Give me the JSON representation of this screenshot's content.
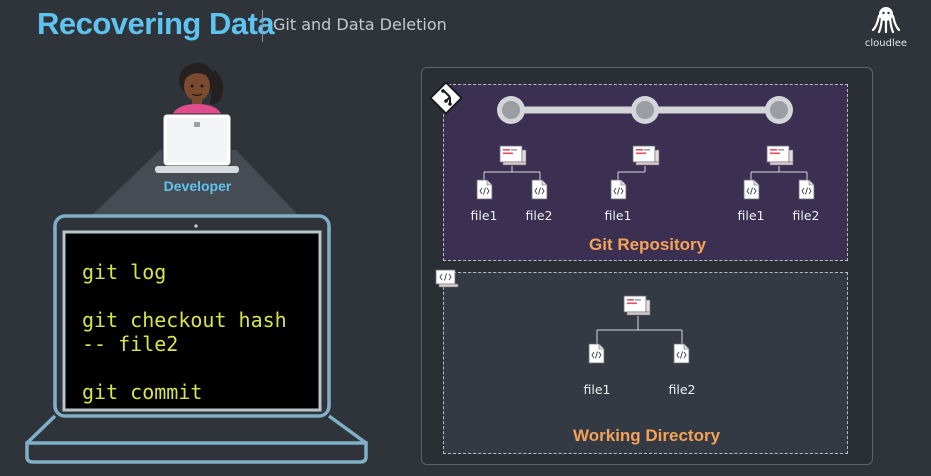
{
  "header": {
    "title": "Recovering Data",
    "subtitle": "Git and Data Deletion",
    "brand": "cloudlee"
  },
  "developer": {
    "label": "Developer"
  },
  "terminal": {
    "lines": [
      "git log",
      "",
      "git checkout hash",
      "-- file2",
      "",
      "git commit"
    ]
  },
  "repository": {
    "label": "Git Repository",
    "commits": [
      {
        "files": [
          "file1",
          "file2"
        ]
      },
      {
        "files": [
          "file1"
        ]
      },
      {
        "files": [
          "file1",
          "file2"
        ]
      }
    ]
  },
  "working_directory": {
    "label": "Working Directory",
    "files": [
      "file1",
      "file2"
    ]
  },
  "colors": {
    "title_blue": "#5ec3ee",
    "terminal_text": "#d9e34a",
    "label_orange": "#f4a258",
    "repo_background": "#3b2f52",
    "developer_shirt": "#e14d8c"
  }
}
